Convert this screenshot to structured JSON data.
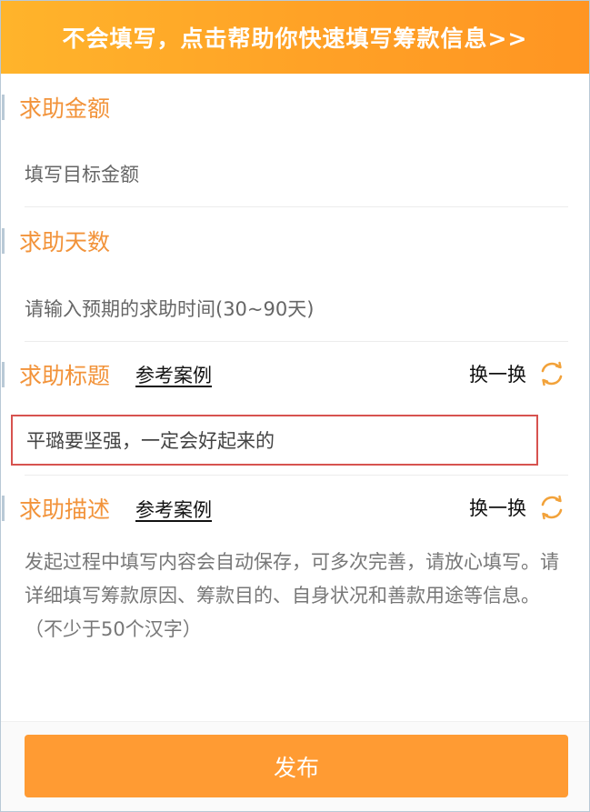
{
  "banner": {
    "text": "不会填写，点击帮助你快速填写筹款信息>>"
  },
  "amount": {
    "label": "求助金额",
    "placeholder": "填写目标金额"
  },
  "days": {
    "label": "求助天数",
    "placeholder": "请输入预期的求助时间(30~90天)"
  },
  "title": {
    "label": "求助标题",
    "ref_link": "参考案例",
    "swap_label": "换一换",
    "value": "平璐要坚强，一定会好起来的"
  },
  "description": {
    "label": "求助描述",
    "ref_link": "参考案例",
    "swap_label": "换一换",
    "placeholder": "发起过程中填写内容会自动保存，可多次完善，请放心填写。请详细填写筹款原因、筹款目的、自身状况和善款用途等信息。（不少于50个汉字）"
  },
  "footer": {
    "publish_label": "发布"
  },
  "colors": {
    "accent": "#f2933a",
    "banner": "#ffa126",
    "button": "#ff9b33",
    "error_border": "#d7534f"
  }
}
